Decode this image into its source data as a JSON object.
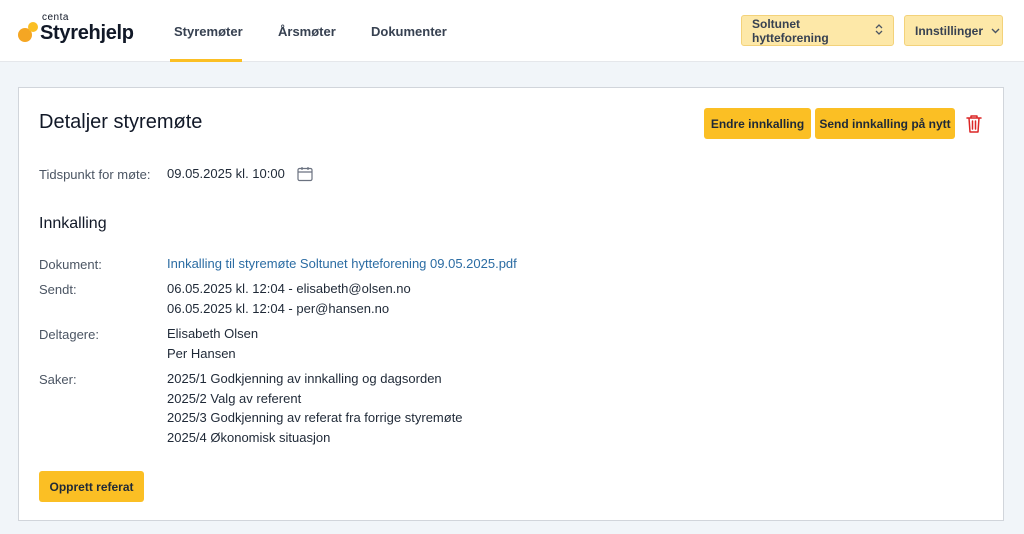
{
  "brand": {
    "small": "centa",
    "name": "Styrehjelp"
  },
  "nav": [
    {
      "label": "Styremøter",
      "active": true
    },
    {
      "label": "Årsmøter",
      "active": false
    },
    {
      "label": "Dokumenter",
      "active": false
    }
  ],
  "header": {
    "org_select": "Soltunet hytteforening",
    "settings": "Innstillinger"
  },
  "card": {
    "title": "Detaljer styremøte",
    "edit_button": "Endre innkalling",
    "resend_button": "Send innkalling på nytt",
    "time_label": "Tidspunkt for møte:",
    "time_value": "09.05.2025 kl. 10:00",
    "section_title": "Innkalling",
    "doc_label": "Dokument:",
    "doc_link": "Innkalling til styremøte Soltunet hytteforening 09.05.2025.pdf",
    "sent_label": "Sendt:",
    "sent": [
      "06.05.2025 kl. 12:04 - elisabeth@olsen.no",
      "06.05.2025 kl. 12:04 - per@hansen.no"
    ],
    "participants_label": "Deltagere:",
    "participants": [
      "Elisabeth Olsen",
      "Per Hansen"
    ],
    "cases_label": "Saker:",
    "cases": [
      "2025/1 Godkjenning av innkalling og dagsorden",
      "2025/2 Valg av referent",
      "2025/3 Godkjenning av referat fra forrige styremøte",
      "2025/4 Økonomisk situasjon"
    ],
    "create_minutes_button": "Opprett referat"
  },
  "colors": {
    "accent": "#fbbf24",
    "link": "#2b6ca3",
    "danger": "#dc2626"
  },
  "icons": {
    "calendar": "calendar-icon",
    "trash": "trash-icon",
    "select": "chevron-updown-icon",
    "dropdown": "chevron-down-icon"
  }
}
